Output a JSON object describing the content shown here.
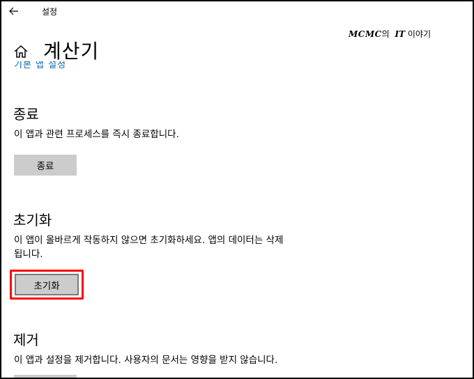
{
  "window": {
    "title": "설정",
    "back_icon": "arrow-left-icon"
  },
  "watermark": {
    "brand": "MCMC",
    "mid": "의 ",
    "brand2": "IT",
    "tail": " 이야기"
  },
  "header": {
    "home_icon": "home-icon",
    "title": "계산기",
    "default_apps_link": "기본 앱 설정"
  },
  "sections": {
    "terminate": {
      "heading": "종료",
      "description": "이 앱과 관련 프로세스를 즉시 종료합니다.",
      "button_label": "종료"
    },
    "reset": {
      "heading": "초기화",
      "description_line1": "이 앱이 올바르게 작동하지 않으면 초기화하세요. 앱의 데이터는 삭제",
      "description_line2": "됩니다.",
      "button_label": "초기화"
    },
    "uninstall": {
      "heading": "제거",
      "description": "이 앱과 설정을 제거합니다. 사용자의 문서는 영향을 받지 않습니다."
    }
  },
  "colors": {
    "link": "#0066b4",
    "button_bg": "#cccccc",
    "highlight": "#ff0000"
  }
}
